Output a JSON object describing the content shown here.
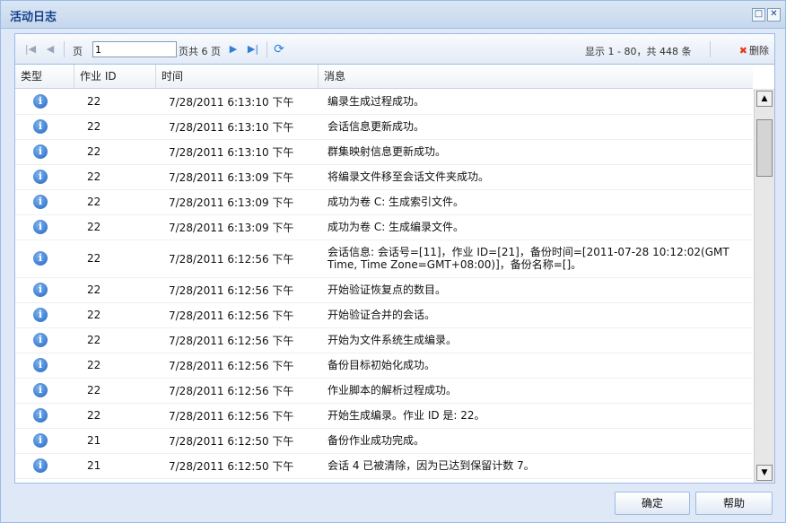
{
  "window": {
    "title": "活动日志"
  },
  "toolbar": {
    "page_label": "页",
    "page_value": "1",
    "page_total": "页共 6 页",
    "display_info": "显示 1 - 80，共 448 条",
    "delete_label": "删除"
  },
  "columns": {
    "type": "类型",
    "job_id": "作业 ID",
    "time": "时间",
    "message": "消息"
  },
  "rows": [
    {
      "job_id": "22",
      "time": "7/28/2011 6:13:10 下午",
      "message": "编录生成过程成功。"
    },
    {
      "job_id": "22",
      "time": "7/28/2011 6:13:10 下午",
      "message": "会话信息更新成功。"
    },
    {
      "job_id": "22",
      "time": "7/28/2011 6:13:10 下午",
      "message": "群集映射信息更新成功。"
    },
    {
      "job_id": "22",
      "time": "7/28/2011 6:13:09 下午",
      "message": "将编录文件移至会话文件夹成功。"
    },
    {
      "job_id": "22",
      "time": "7/28/2011 6:13:09 下午",
      "message": "成功为卷 C: 生成索引文件。"
    },
    {
      "job_id": "22",
      "time": "7/28/2011 6:13:09 下午",
      "message": "成功为卷 C: 生成编录文件。"
    },
    {
      "job_id": "22",
      "time": "7/28/2011 6:12:56 下午",
      "message": "会话信息: 会话号=[11]，作业 ID=[21]，备份时间=[2011-07-28 10:12:02(GMT Time, Time Zone=GMT+08:00)]，备份名称=[]。"
    },
    {
      "job_id": "22",
      "time": "7/28/2011 6:12:56 下午",
      "message": "开始验证恢复点的数目。"
    },
    {
      "job_id": "22",
      "time": "7/28/2011 6:12:56 下午",
      "message": "开始验证合并的会话。"
    },
    {
      "job_id": "22",
      "time": "7/28/2011 6:12:56 下午",
      "message": "开始为文件系统生成编录。"
    },
    {
      "job_id": "22",
      "time": "7/28/2011 6:12:56 下午",
      "message": "备份目标初始化成功。"
    },
    {
      "job_id": "22",
      "time": "7/28/2011 6:12:56 下午",
      "message": "作业脚本的解析过程成功。"
    },
    {
      "job_id": "22",
      "time": "7/28/2011 6:12:56 下午",
      "message": "开始生成编录。作业 ID 是: 22。"
    },
    {
      "job_id": "21",
      "time": "7/28/2011 6:12:50 下午",
      "message": "备份作业成功完成。"
    },
    {
      "job_id": "21",
      "time": "7/28/2011 6:12:50 下午",
      "message": "会话 4 已被清除，因为已达到保留计数 7。"
    }
  ],
  "buttons": {
    "ok": "确定",
    "help": "帮助"
  }
}
